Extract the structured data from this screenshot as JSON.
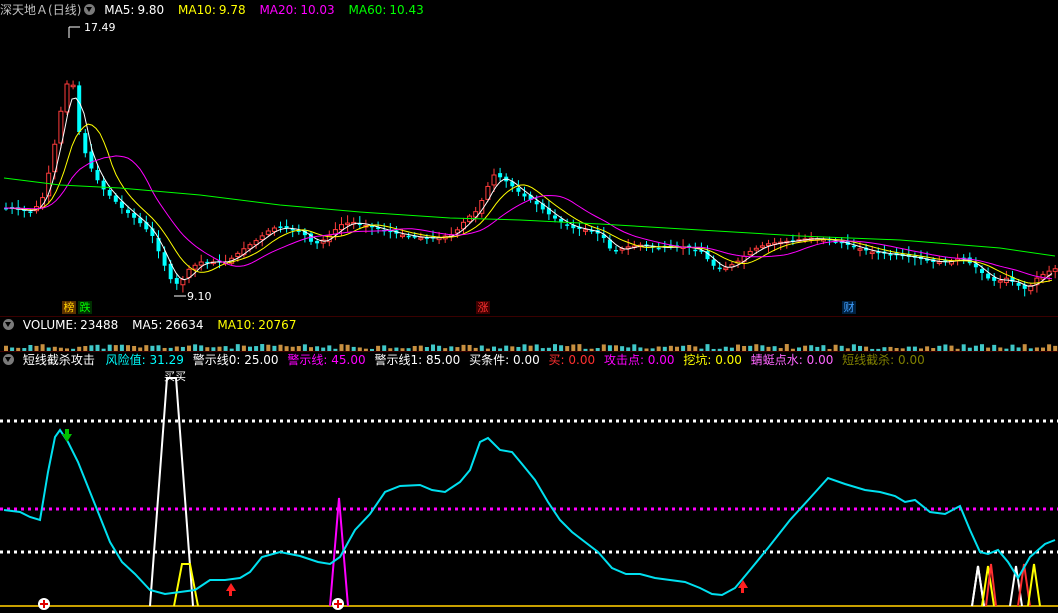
{
  "main": {
    "symbol": "深天地Ａ",
    "period": "(日线)",
    "indicators": [
      {
        "label": "MA5:",
        "value": "9.80",
        "color": "#ffffff"
      },
      {
        "label": "MA10:",
        "value": "9.78",
        "color": "#ffff00"
      },
      {
        "label": "MA20:",
        "value": "10.03",
        "color": "#ff00ff"
      },
      {
        "label": "MA60:",
        "value": "10.43",
        "color": "#00ff00"
      }
    ],
    "high_marker": "17.49",
    "low_marker": "9.10",
    "tags": [
      {
        "text": "榜",
        "color": "#ffd000",
        "bg": "#5a3000"
      },
      {
        "text": "跌",
        "color": "#00ff00",
        "bg": "#003000"
      },
      {
        "text": "涨",
        "color": "#ff3030",
        "bg": "#400000"
      },
      {
        "text": "财",
        "color": "#40a0ff",
        "bg": "#002040"
      }
    ]
  },
  "volume": {
    "label": "VOLUME:",
    "value": "23488",
    "ma5_label": "MA5:",
    "ma5_value": "26634",
    "ma10_label": "MA10:",
    "ma10_value": "20767"
  },
  "indicator": {
    "name": "短线截杀攻击",
    "params": [
      {
        "text": "风险值: 31.29",
        "color": "#00ffff"
      },
      {
        "text": "警示线0: 25.00",
        "color": "#ffffff"
      },
      {
        "text": "警示线: 45.00",
        "color": "#ff00ff"
      },
      {
        "text": "警示线1: 85.00",
        "color": "#ffffff"
      },
      {
        "text": "买条件: 0.00",
        "color": "#ffffff"
      },
      {
        "text": "买: 0.00",
        "color": "#ff3030"
      },
      {
        "text": "攻击点: 0.00",
        "color": "#ff00ff"
      },
      {
        "text": "挖坑: 0.00",
        "color": "#ffff00"
      },
      {
        "text": "蜻蜓点水: 0.00",
        "color": "#ff66ff"
      },
      {
        "text": "短线截杀: 0.00",
        "color": "#808000"
      }
    ],
    "buy_label": "买买"
  },
  "colors": {
    "up": "#ff3c3c",
    "down": "#00ffff",
    "ma5": "#ffffff",
    "ma10": "#ffff00",
    "ma20": "#ff00ff",
    "ma60": "#00ff00",
    "risk": "#00e0f0"
  }
}
